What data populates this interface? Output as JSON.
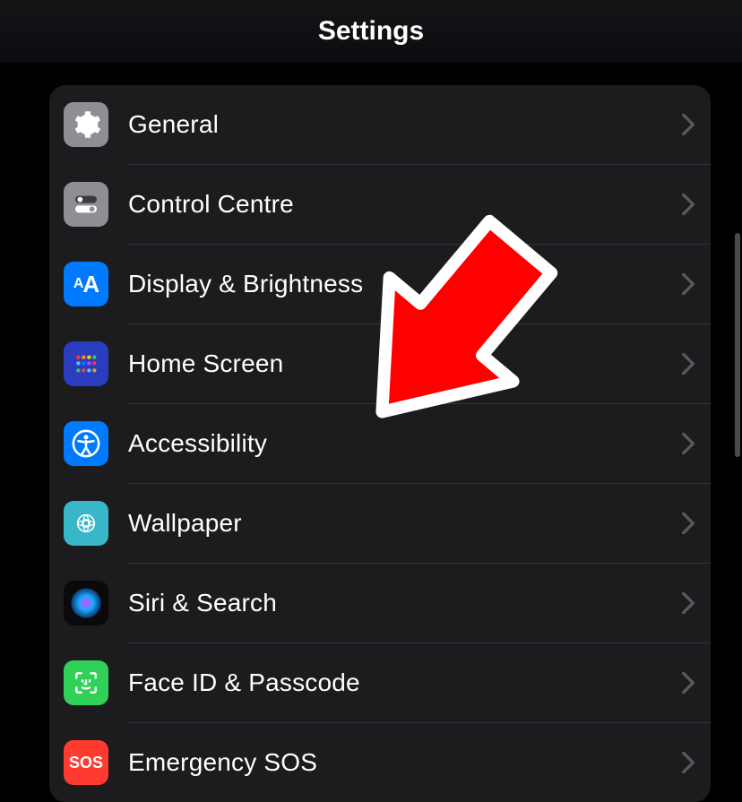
{
  "header": {
    "title": "Settings"
  },
  "rows": [
    {
      "id": "general",
      "label": "General"
    },
    {
      "id": "control-centre",
      "label": "Control Centre"
    },
    {
      "id": "display",
      "label": "Display & Brightness"
    },
    {
      "id": "home-screen",
      "label": "Home Screen"
    },
    {
      "id": "accessibility",
      "label": "Accessibility"
    },
    {
      "id": "wallpaper",
      "label": "Wallpaper"
    },
    {
      "id": "siri",
      "label": "Siri & Search"
    },
    {
      "id": "faceid",
      "label": "Face ID & Passcode"
    },
    {
      "id": "sos",
      "label": "Emergency SOS"
    }
  ],
  "annotation": {
    "points_to": "accessibility"
  }
}
